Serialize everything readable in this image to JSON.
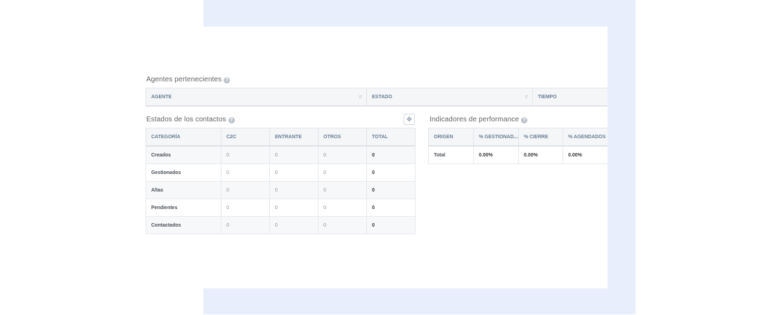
{
  "agents": {
    "title": "Agentes pertenecientes",
    "help_icon": "question-circle-icon",
    "columns": [
      "AGENTE",
      "ESTADO",
      "TIEMPO"
    ]
  },
  "contact_states": {
    "title": "Estados de los contactos",
    "help_icon": "question-circle-icon",
    "expand_icon": "move-arrows-icon",
    "columns": [
      "CATEGORÍA",
      "C2C",
      "ENTRANTE",
      "OTROS",
      "TOTAL"
    ],
    "rows": [
      [
        "Creados",
        "0",
        "0",
        "0",
        "0"
      ],
      [
        "Gestionados",
        "0",
        "0",
        "0",
        "0"
      ],
      [
        "Altas",
        "0",
        "0",
        "0",
        "0"
      ],
      [
        "Pendientes",
        "0",
        "0",
        "0",
        "0"
      ],
      [
        "Contactados",
        "0",
        "0",
        "0",
        "0"
      ]
    ]
  },
  "performance": {
    "title": "Indicadores de performance",
    "help_icon": "question-circle-icon",
    "columns": [
      "ORIGEN",
      "% GESTIONAD...",
      "% CIERRE",
      "% AGENDADOS"
    ],
    "rows": [
      [
        "Total",
        "0.00%",
        "0.00%",
        "0.00%"
      ]
    ]
  },
  "colors": {
    "panel_bg": "#e8eefb",
    "header_text": "#6a7f96"
  }
}
